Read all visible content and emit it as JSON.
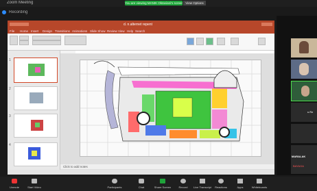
{
  "zoom": {
    "window_title": "Zoom Meeting",
    "share_banner": "You are viewing MANIK Oktaviani's screen",
    "stop_share_label": "View Options",
    "second_bar_label": "Recording"
  },
  "ppt": {
    "title": "d. n.alternet repent",
    "menu": [
      "File",
      "Home",
      "Insert",
      "Design",
      "Transitions",
      "Animations",
      "Slide Show",
      "Review",
      "View",
      "Help",
      "Search"
    ],
    "notes_placeholder": "Click to add notes",
    "thumbs": [
      "1",
      "2",
      "3",
      "4"
    ]
  },
  "gallery": {
    "names": [
      "",
      "",
      "",
      "u.Ra",
      "",
      "",
      "MARALAK",
      "BAYAGA"
    ]
  },
  "toolbar": {
    "items": [
      "Unmute",
      "Start Video",
      "Participants",
      "Chat",
      "Share Screen",
      "Record",
      "Live Transcript",
      "Reactions",
      "Apps",
      "Whiteboards"
    ]
  },
  "colors": {
    "accent": "#b7472a",
    "zoom_green": "#1fa33a"
  }
}
